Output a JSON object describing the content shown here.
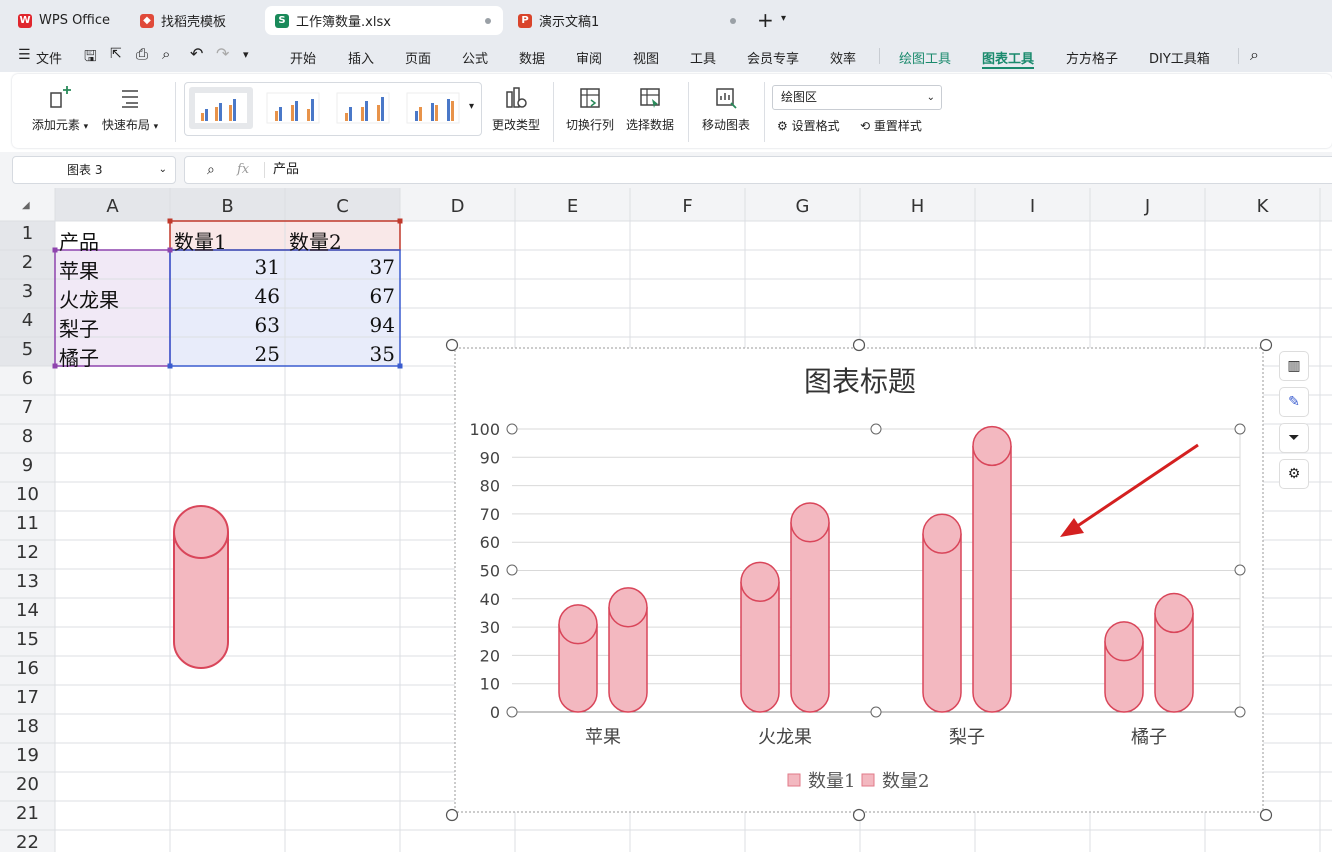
{
  "tabs": [
    {
      "label": "WPS Office",
      "icon": "wps-logo-icon"
    },
    {
      "label": "找稻壳模板",
      "icon": "docer-icon"
    },
    {
      "label": "工作簿数量.xlsx",
      "icon": "spreadsheet-icon"
    },
    {
      "label": "演示文稿1",
      "icon": "presentation-icon"
    }
  ],
  "menu": {
    "file": "文件",
    "items": [
      "开始",
      "插入",
      "页面",
      "公式",
      "数据",
      "审阅",
      "视图",
      "工具",
      "会员专享",
      "效率",
      "绘图工具",
      "图表工具",
      "方方格子",
      "DIY工具箱"
    ],
    "active": "图表工具"
  },
  "ribbon": {
    "add_element": "添加元素",
    "quick_layout": "快速布局",
    "change_type": "更改类型",
    "switch_rowcol": "切换行列",
    "select_data": "选择数据",
    "move_chart": "移动图表",
    "area_select": "绘图区",
    "set_format": "设置格式",
    "reset_style": "重置样式"
  },
  "formula_bar": {
    "name_box": "图表 3",
    "fx": "fx",
    "content": "产品"
  },
  "columns": [
    "A",
    "B",
    "C",
    "D",
    "E",
    "F",
    "G",
    "H",
    "I",
    "J",
    "K"
  ],
  "rows": [
    "1",
    "2",
    "3",
    "4",
    "5",
    "6",
    "7",
    "8",
    "9",
    "10",
    "11",
    "12",
    "13",
    "14",
    "15",
    "16",
    "17",
    "18",
    "19",
    "20",
    "21",
    "22"
  ],
  "table": {
    "header": [
      "产品",
      "数量1",
      "数量2"
    ],
    "rows": [
      [
        "苹果",
        "31",
        "37"
      ],
      [
        "火龙果",
        "46",
        "67"
      ],
      [
        "梨子",
        "63",
        "94"
      ],
      [
        "橘子",
        "25",
        "35"
      ]
    ]
  },
  "chart_data": {
    "type": "bar",
    "title": "图表标题",
    "categories": [
      "苹果",
      "火龙果",
      "梨子",
      "橘子"
    ],
    "series": [
      {
        "name": "数量1",
        "values": [
          31,
          46,
          63,
          25
        ]
      },
      {
        "name": "数量2",
        "values": [
          37,
          67,
          94,
          35
        ]
      }
    ],
    "ylim": [
      0,
      100
    ],
    "yticks": [
      "0",
      "10",
      "20",
      "30",
      "40",
      "50",
      "60",
      "70",
      "80",
      "90",
      "100"
    ],
    "grid": true,
    "legend": "bottom",
    "color": "#f3b8c0",
    "stroke": "#d9465a",
    "shape": "cylinder"
  },
  "colors": {
    "accent_green": "#1a8a6d",
    "select_red": "#c0392b",
    "select_blue": "#3a5ccf",
    "arrow_red": "#d42020"
  }
}
